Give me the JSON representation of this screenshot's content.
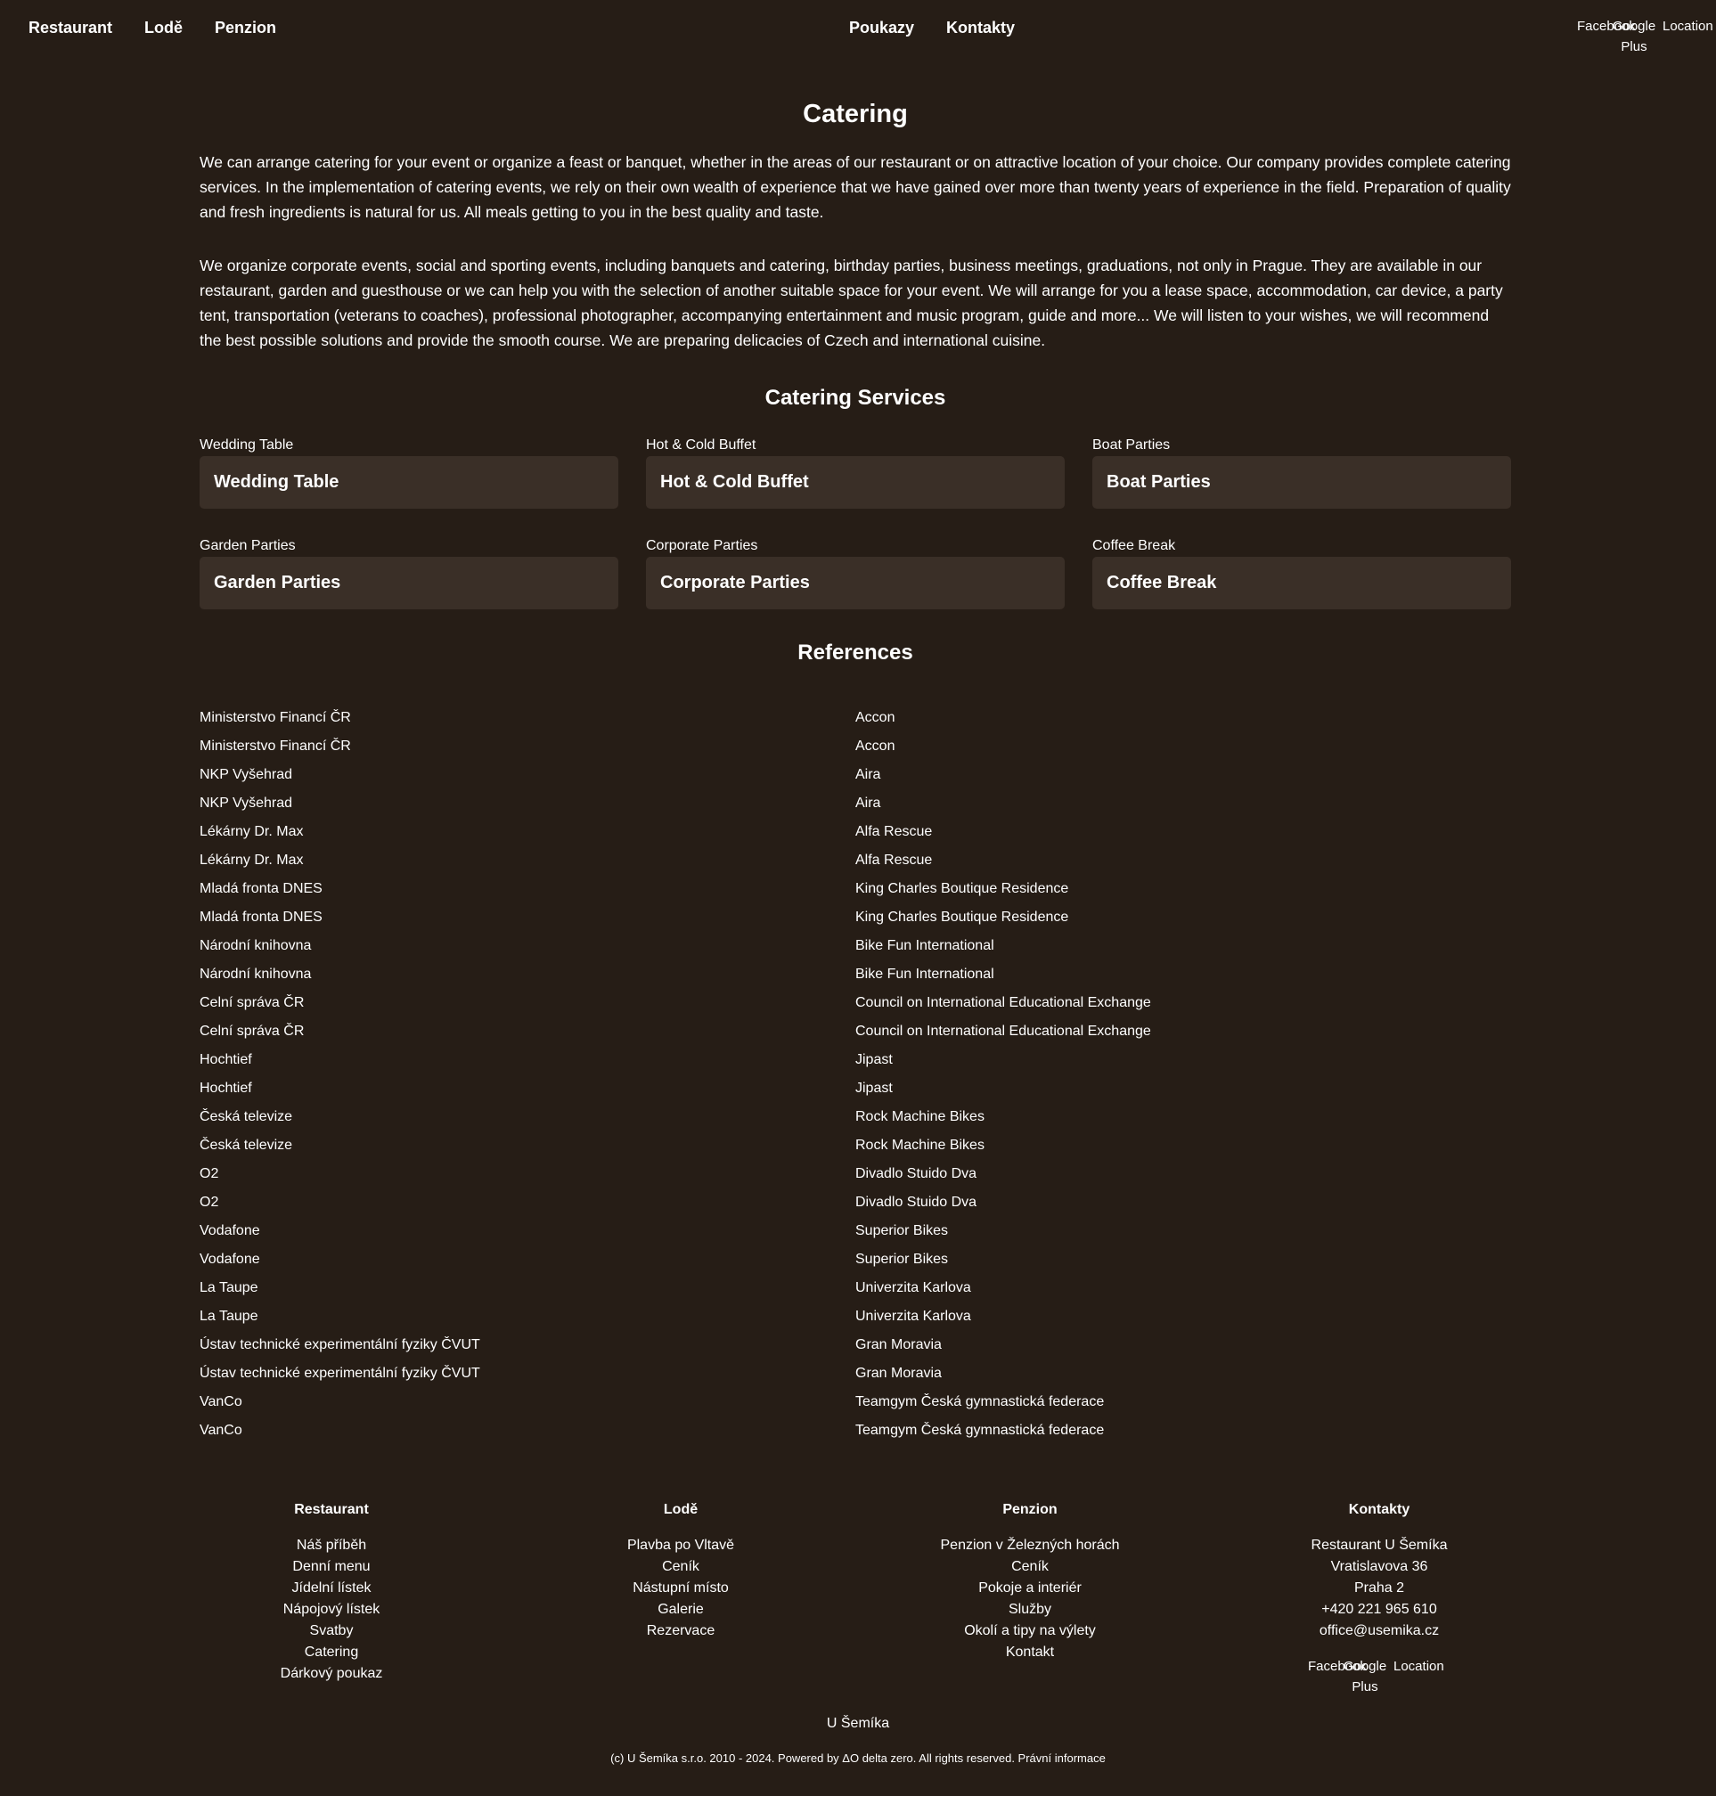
{
  "nav": {
    "left": [
      "Restaurant",
      "Lodě",
      "Penzion"
    ],
    "center": [
      "Poukazy",
      "Kontakty"
    ],
    "social": {
      "facebook": "Facebook",
      "google_plus": "Google Plus",
      "location": "Location"
    }
  },
  "page": {
    "title": "Catering",
    "paragraphs": [
      "We can arrange catering for your event or organize a feast or banquet, whether in the areas of our restaurant or on attractive location of your choice. Our company provides complete catering services. In the implementation of catering events, we rely on their own wealth of experience that we have gained over more than twenty years of experience in the field. Preparation of quality and fresh ingredients is natural for us. All meals getting to you in the best quality and taste.",
      "We organize corporate events, social and sporting events, including banquets and catering, birthday parties, business meetings, graduations, not only in Prague. They are available in our restaurant, garden and guesthouse or we can help you with the selection of another suitable space for your event. We will arrange for you a lease space, accommodation, car device, a party tent, transportation (veterans to coaches), professional photographer, accompanying entertainment and music program, guide and more... We will listen to your wishes, we will recommend the best possible solutions and provide the smooth course. We are preparing delicacies of Czech and international cuisine."
    ],
    "services_title": "Catering Services",
    "services": [
      {
        "caption": "Wedding Table",
        "name": "Wedding Table"
      },
      {
        "caption": "Hot & Cold Buffet",
        "name": "Hot & Cold Buffet"
      },
      {
        "caption": "Boat Parties",
        "name": "Boat Parties"
      },
      {
        "caption": "Garden Parties",
        "name": "Garden Parties"
      },
      {
        "caption": "Corporate Parties",
        "name": "Corporate Parties"
      },
      {
        "caption": "Coffee Break",
        "name": "Coffee Break"
      }
    ],
    "references_title": "References",
    "references_left": [
      "Ministerstvo Financí ČR",
      "Ministerstvo Financí ČR",
      "NKP Vyšehrad",
      "NKP Vyšehrad",
      "Lékárny Dr. Max",
      "Lékárny Dr. Max",
      "Mladá fronta DNES",
      "Mladá fronta DNES",
      "Národní knihovna",
      "Národní knihovna",
      "Celní správa ČR",
      "Celní správa ČR",
      "Hochtief",
      "Hochtief",
      "Česká televize",
      "Česká televize",
      "O2",
      "O2",
      "Vodafone",
      "Vodafone",
      "La Taupe",
      "La Taupe",
      "Ústav technické experimentální fyziky ČVUT",
      "Ústav technické experimentální fyziky ČVUT",
      "VanCo",
      "VanCo"
    ],
    "references_right": [
      "Accon",
      "Accon",
      "Aira",
      "Aira",
      "Alfa Rescue",
      "Alfa Rescue",
      "King Charles Boutique Residence",
      "King Charles Boutique Residence",
      "Bike Fun International",
      "Bike Fun International",
      "Council on International Educational Exchange",
      "Council on International Educational Exchange",
      "Jipast",
      "Jipast",
      "Rock Machine Bikes",
      "Rock Machine Bikes",
      "Divadlo Stuido Dva",
      "Divadlo Stuido Dva",
      "Superior Bikes",
      "Superior Bikes",
      "Univerzita Karlova",
      "Univerzita Karlova",
      "Gran Moravia",
      "Gran Moravia",
      "Teamgym Česká gymnastická federace",
      "Teamgym Česká gymnastická federace"
    ]
  },
  "footer": {
    "columns": [
      {
        "title": "Restaurant",
        "links": [
          "Náš příběh",
          "Denní menu",
          "Jídelní lístek",
          "Nápojový lístek",
          "Svatby",
          "Catering",
          "Dárkový poukaz"
        ]
      },
      {
        "title": "Lodě",
        "links": [
          "Plavba po Vltavě",
          "Ceník",
          "Nástupní místo",
          "Galerie",
          "Rezervace"
        ]
      },
      {
        "title": "Penzion",
        "links": [
          "Penzion v Železných horách",
          "Ceník",
          "Pokoje a interiér",
          "Služby",
          "Okolí a tipy na výlety",
          "Kontakt"
        ]
      },
      {
        "title": "Kontakty",
        "links": [
          "Restaurant U Šemíka",
          "Vratislavova 36",
          "Praha 2",
          "+420 221 965 610",
          "office@usemika.cz"
        ]
      }
    ],
    "social": {
      "facebook": "Facebook",
      "google_plus": "Google Plus",
      "location": "Location"
    },
    "brand": "U Šemíka",
    "copyright": "(c) U Šemíka s.r.o. 2010 - 2024. Powered by ΔO delta zero. All rights reserved. Právní informace"
  }
}
